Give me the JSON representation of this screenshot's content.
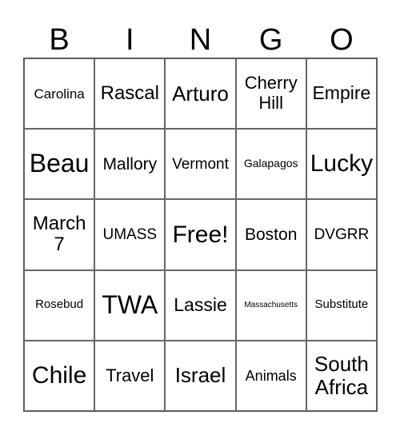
{
  "header": [
    "B",
    "I",
    "N",
    "G",
    "O"
  ],
  "cells": [
    [
      {
        "text": "Carolina",
        "size": 17
      },
      {
        "text": "Rascal",
        "size": 24
      },
      {
        "text": "Arturo",
        "size": 26
      },
      {
        "text": "Cherry Hill",
        "size": 22
      },
      {
        "text": "Empire",
        "size": 23
      }
    ],
    [
      {
        "text": "Beau",
        "size": 32
      },
      {
        "text": "Mallory",
        "size": 21
      },
      {
        "text": "Vermont",
        "size": 19
      },
      {
        "text": "Galapagos",
        "size": 14
      },
      {
        "text": "Lucky",
        "size": 30
      }
    ],
    [
      {
        "text": "March 7",
        "size": 24
      },
      {
        "text": "UMASS",
        "size": 19
      },
      {
        "text": "Free!",
        "size": 30
      },
      {
        "text": "Boston",
        "size": 21
      },
      {
        "text": "DVGRR",
        "size": 19
      }
    ],
    [
      {
        "text": "Rosebud",
        "size": 15
      },
      {
        "text": "TWA",
        "size": 32
      },
      {
        "text": "Lassie",
        "size": 23
      },
      {
        "text": "Massachusetts",
        "size": 10
      },
      {
        "text": "Substitute",
        "size": 15
      }
    ],
    [
      {
        "text": "Chile",
        "size": 30
      },
      {
        "text": "Travel",
        "size": 22
      },
      {
        "text": "Israel",
        "size": 26
      },
      {
        "text": "Animals",
        "size": 18
      },
      {
        "text": "South Africa",
        "size": 26
      }
    ]
  ]
}
